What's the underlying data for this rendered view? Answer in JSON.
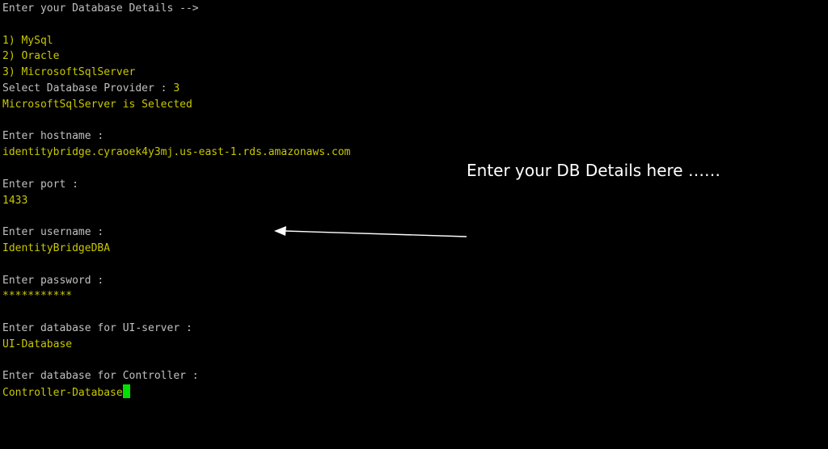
{
  "terminal": {
    "lines": [
      {
        "text": "Enter your Database Details -->",
        "kind": "prompt"
      },
      {
        "text": "",
        "kind": "blank"
      },
      {
        "text": "1) MySql",
        "kind": "value"
      },
      {
        "text": "2) Oracle",
        "kind": "value"
      },
      {
        "text": "3) MicrosoftSqlServer",
        "kind": "value"
      },
      {
        "text": "Select Database Provider : ",
        "kind": "prompt",
        "input": "3"
      },
      {
        "text": "MicrosoftSqlServer is Selected",
        "kind": "value"
      },
      {
        "text": "",
        "kind": "blank"
      },
      {
        "text": "Enter hostname :",
        "kind": "prompt"
      },
      {
        "text": "identitybridge.cyraoek4y3mj.us-east-1.rds.amazonaws.com",
        "kind": "value"
      },
      {
        "text": "",
        "kind": "blank"
      },
      {
        "text": "Enter port :",
        "kind": "prompt"
      },
      {
        "text": "1433",
        "kind": "value"
      },
      {
        "text": "",
        "kind": "blank"
      },
      {
        "text": "Enter username :",
        "kind": "prompt"
      },
      {
        "text": "IdentityBridgeDBA",
        "kind": "value"
      },
      {
        "text": "",
        "kind": "blank"
      },
      {
        "text": "Enter password :",
        "kind": "prompt"
      },
      {
        "text": "***********",
        "kind": "value"
      },
      {
        "text": "",
        "kind": "blank"
      },
      {
        "text": "Enter database for UI-server :",
        "kind": "prompt"
      },
      {
        "text": "UI-Database",
        "kind": "value"
      },
      {
        "text": "",
        "kind": "blank"
      },
      {
        "text": "Enter database for Controller :",
        "kind": "prompt"
      },
      {
        "text": "Controller-Database",
        "kind": "value",
        "cursor": true
      }
    ]
  },
  "annotation": {
    "text": "Enter your DB Details here ……"
  },
  "colors": {
    "background": "#000000",
    "prompt": "#c0c0c0",
    "value": "#c8c800",
    "cursor": "#00e000",
    "annotation": "#ffffff"
  }
}
